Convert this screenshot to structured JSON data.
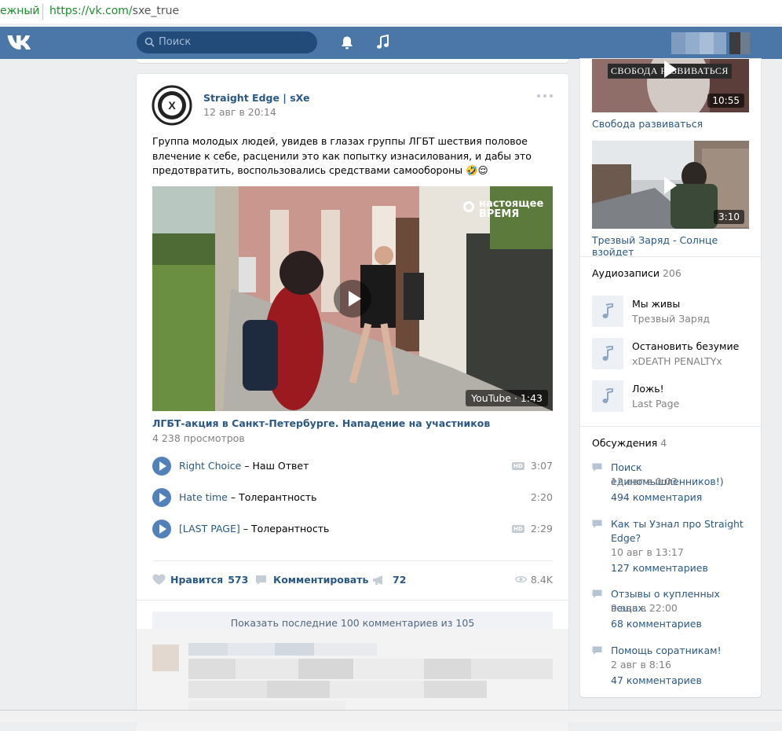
{
  "browser": {
    "secure_label": "ежный",
    "url_host": "https://vk.com/",
    "url_path": "sxe_true"
  },
  "header": {
    "search_placeholder": "Поиск"
  },
  "post": {
    "group_name": "Straight Edge | sXe",
    "date": "12 авг в 20:14",
    "text": "Группа молодых людей, увидев в глазах группы ЛГБТ шествия половое влечение к себе, расценили это как попытку изнасилования, и дабы это предотвратить, воспользовались средствами самообороны 🤣😌",
    "video": {
      "watermark_line1": "настоящее",
      "watermark_line2": "время",
      "badge": "YouTube · 1:43",
      "title": "ЛГБТ-акция в Санкт-Петербурге. Нападение на участников",
      "views": "4 238 просмотров"
    },
    "tracks": [
      {
        "title": "Right Choice",
        "artist": "Наш Ответ",
        "hd": "HD",
        "duration": "3:07"
      },
      {
        "title": "Hate time",
        "artist": "Толерантность",
        "hd": "",
        "duration": "2:20"
      },
      {
        "title": "[LAST PAGE]",
        "artist": "Толерантность",
        "hd": "HD",
        "duration": "2:29"
      }
    ],
    "actions": {
      "like_label": "Нравится",
      "like_count": "573",
      "comment_label": "Комментировать",
      "share_count": "72",
      "views": "8.4K"
    },
    "show_more": "Показать последние 100 комментариев из 105"
  },
  "sidebar": {
    "videos": [
      {
        "title": "Свобода развиваться",
        "duration": "10:55",
        "overlay": "СВОБОДА РАЗВИВАТЬСЯ"
      },
      {
        "title": "Трезвый Заряд - Солнце взойдет",
        "duration": "3:10"
      }
    ],
    "audio_header": "Аудиозаписи",
    "audio_count": "206",
    "audios": [
      {
        "title": "Мы живы",
        "artist": "Трезвый Заряд"
      },
      {
        "title": "Остановить безумие",
        "artist": "xDEATH PENALTYx"
      },
      {
        "title": "Ложь!",
        "artist": "Last Page"
      }
    ],
    "discussions_header": "Обсуждения",
    "discussions_count": "4",
    "discussions": [
      {
        "title": "Поиск единомышленников!)",
        "date": "12 авг в 0:03",
        "comments": "494 комментария"
      },
      {
        "title": "Как ты Узнал про Straight Edge?",
        "date": "10 авг в 13:17",
        "comments": "127 комментариев"
      },
      {
        "title": "Отзывы о купленных вещах.",
        "date": "9 авг в 22:00",
        "comments": "68 комментариев"
      },
      {
        "title": "Помощь соратникам!",
        "date": "2 авг в 8:16",
        "comments": "47 комментариев"
      }
    ]
  },
  "colors": {
    "header_blue": "#4a76a8",
    "link_blue": "#2a5885",
    "play_blue": "#5181b8",
    "muted": "#828282"
  }
}
